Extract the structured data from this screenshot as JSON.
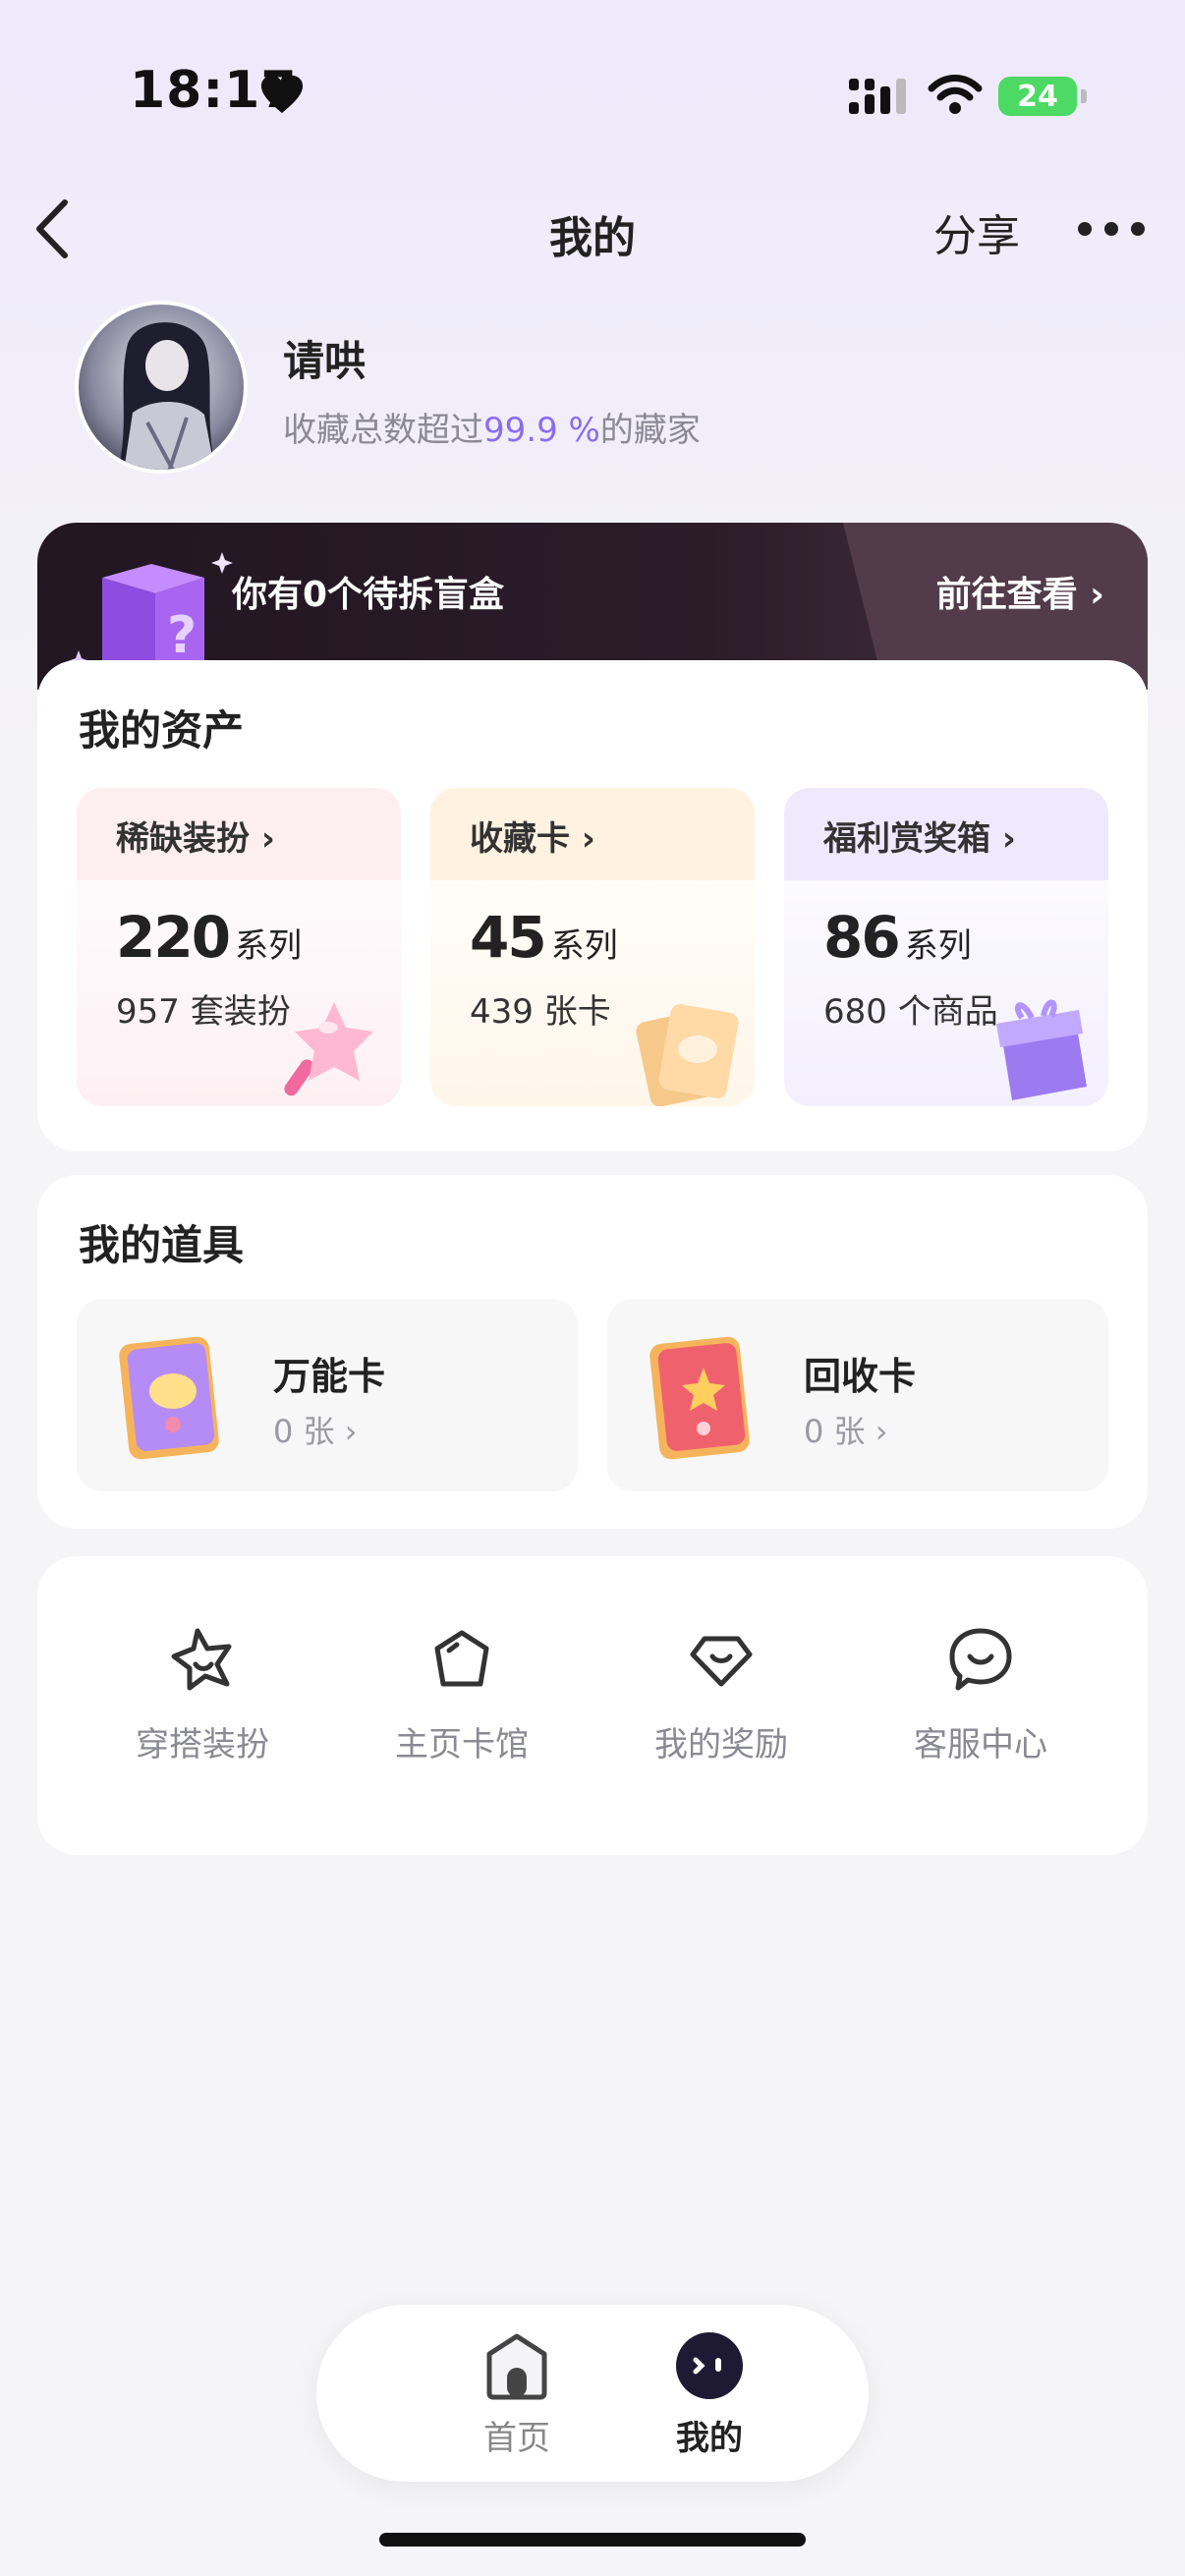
{
  "status_bar": {
    "time": "18:17",
    "battery": "24"
  },
  "nav": {
    "title": "我的",
    "share_label": "分享"
  },
  "profile": {
    "username": "请哄",
    "collector_prefix": "收藏总数超过",
    "collector_percent": "99.9 %",
    "collector_suffix": "的藏家"
  },
  "blind_box_banner": {
    "text": "你有0个待拆盲盒",
    "link": "前往查看 ›"
  },
  "assets": {
    "title": "我的资产",
    "tiles": [
      {
        "label": "稀缺装扮 ›",
        "count": "220",
        "unit": "系列",
        "sub": "957 套装扮"
      },
      {
        "label": "收藏卡 ›",
        "count": "45",
        "unit": "系列",
        "sub": "439 张卡"
      },
      {
        "label": "福利赏奖箱 ›",
        "count": "86",
        "unit": "系列",
        "sub": "680 个商品"
      }
    ]
  },
  "props": {
    "title": "我的道具",
    "items": [
      {
        "name": "万能卡",
        "count": "0 张 ›"
      },
      {
        "name": "回收卡",
        "count": "0 张 ›"
      }
    ]
  },
  "quick_links": [
    {
      "label": "穿搭装扮",
      "icon": "star-outfit-icon"
    },
    {
      "label": "主页卡馆",
      "icon": "pentagon-icon"
    },
    {
      "label": "我的奖励",
      "icon": "gem-icon"
    },
    {
      "label": "客服中心",
      "icon": "chat-smile-icon"
    }
  ],
  "bottom_nav": [
    {
      "label": "首页",
      "icon": "home-icon",
      "active": false
    },
    {
      "label": "我的",
      "icon": "mine-face-icon",
      "active": true
    }
  ],
  "colors": {
    "accent_purple": "#8b6cf0",
    "banner_dark": "#2b1c2a",
    "battery_green": "#4cd964"
  }
}
